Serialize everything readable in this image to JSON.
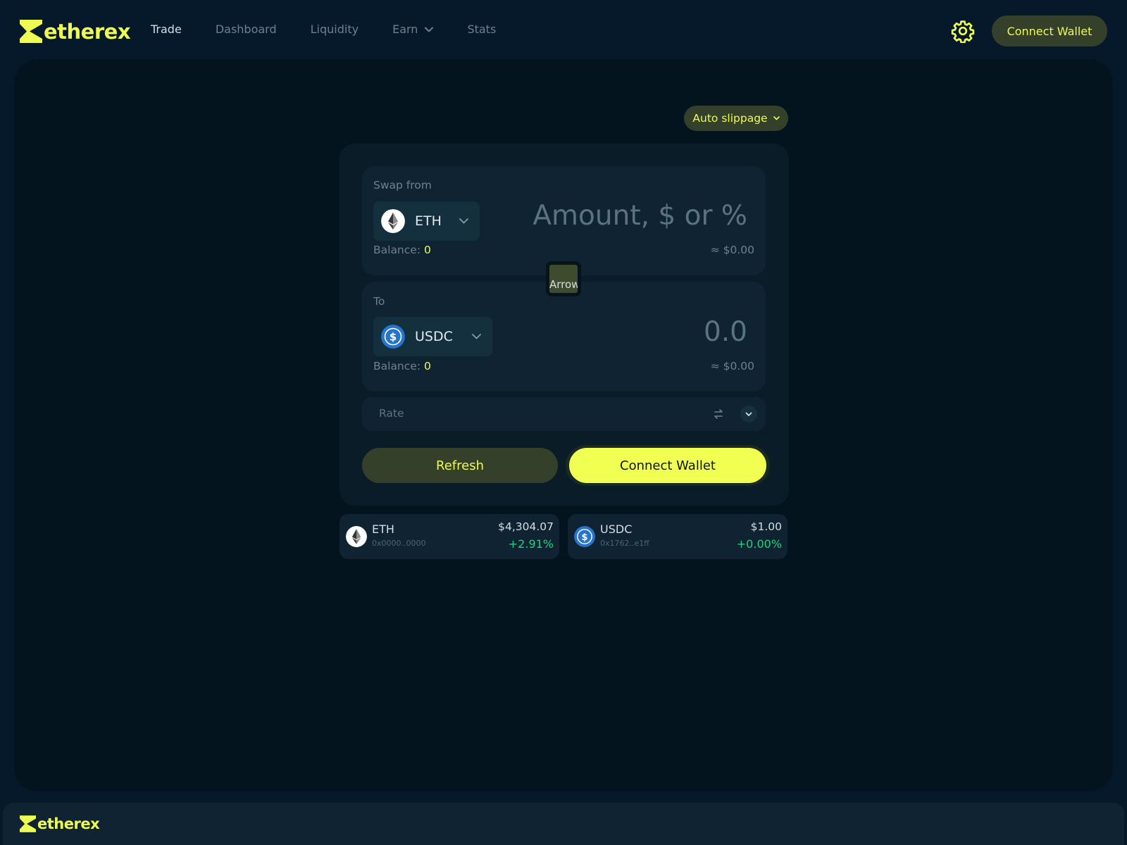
{
  "brand": {
    "name": "etherex",
    "accent": "#eefb52"
  },
  "nav": {
    "items": [
      {
        "label": "Trade",
        "active": true
      },
      {
        "label": "Dashboard",
        "active": false
      },
      {
        "label": "Liquidity",
        "active": false
      },
      {
        "label": "Earn",
        "active": false,
        "has_dropdown": true
      },
      {
        "label": "Stats",
        "active": false
      }
    ]
  },
  "header": {
    "settings_icon": "gear-icon",
    "connect_label": "Connect Wallet"
  },
  "swap": {
    "slippage_label": "Auto slippage",
    "from": {
      "label": "Swap from",
      "token": "ETH",
      "amount_placeholder": "Amount, $ or %",
      "balance_label": "Balance:",
      "balance_value": "0",
      "usd_value": "≈ $0.00"
    },
    "switch_alt": "Arrow",
    "to": {
      "label": "To",
      "token": "USDC",
      "amount": "0.0",
      "balance_label": "Balance:",
      "balance_value": "0",
      "usd_value": "≈ $0.00"
    },
    "rate_label": "Rate",
    "refresh_label": "Refresh",
    "connect_label": "Connect Wallet"
  },
  "prices": [
    {
      "symbol": "ETH",
      "address": "0x0000..0000",
      "price": "$4,304.07",
      "change": "+2.91%"
    },
    {
      "symbol": "USDC",
      "address": "0x1762..e1ff",
      "price": "$1.00",
      "change": "+0.00%"
    }
  ],
  "footer": {
    "brand": "etherex"
  }
}
